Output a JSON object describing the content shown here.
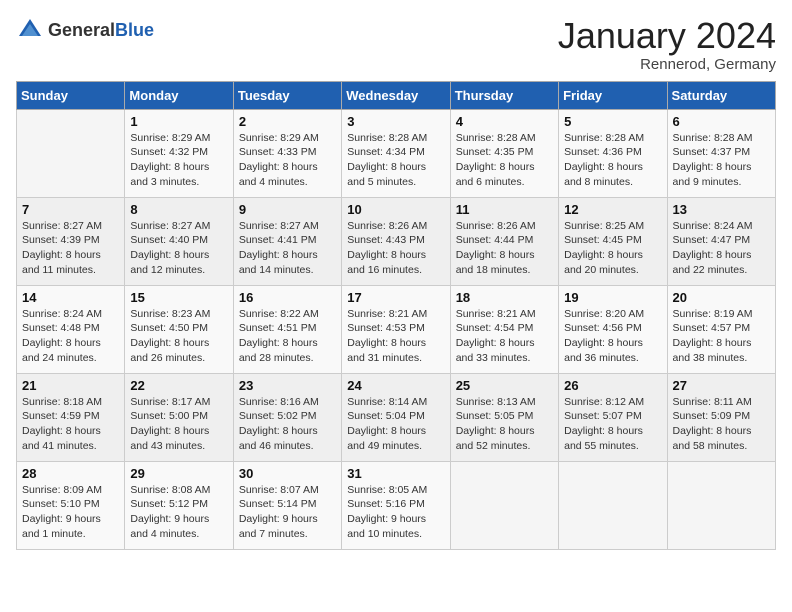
{
  "header": {
    "logo_general": "General",
    "logo_blue": "Blue",
    "month_title": "January 2024",
    "location": "Rennerod, Germany"
  },
  "weekdays": [
    "Sunday",
    "Monday",
    "Tuesday",
    "Wednesday",
    "Thursday",
    "Friday",
    "Saturday"
  ],
  "weeks": [
    [
      {
        "day": "",
        "info": ""
      },
      {
        "day": "1",
        "info": "Sunrise: 8:29 AM\nSunset: 4:32 PM\nDaylight: 8 hours\nand 3 minutes."
      },
      {
        "day": "2",
        "info": "Sunrise: 8:29 AM\nSunset: 4:33 PM\nDaylight: 8 hours\nand 4 minutes."
      },
      {
        "day": "3",
        "info": "Sunrise: 8:28 AM\nSunset: 4:34 PM\nDaylight: 8 hours\nand 5 minutes."
      },
      {
        "day": "4",
        "info": "Sunrise: 8:28 AM\nSunset: 4:35 PM\nDaylight: 8 hours\nand 6 minutes."
      },
      {
        "day": "5",
        "info": "Sunrise: 8:28 AM\nSunset: 4:36 PM\nDaylight: 8 hours\nand 8 minutes."
      },
      {
        "day": "6",
        "info": "Sunrise: 8:28 AM\nSunset: 4:37 PM\nDaylight: 8 hours\nand 9 minutes."
      }
    ],
    [
      {
        "day": "7",
        "info": "Sunrise: 8:27 AM\nSunset: 4:39 PM\nDaylight: 8 hours\nand 11 minutes."
      },
      {
        "day": "8",
        "info": "Sunrise: 8:27 AM\nSunset: 4:40 PM\nDaylight: 8 hours\nand 12 minutes."
      },
      {
        "day": "9",
        "info": "Sunrise: 8:27 AM\nSunset: 4:41 PM\nDaylight: 8 hours\nand 14 minutes."
      },
      {
        "day": "10",
        "info": "Sunrise: 8:26 AM\nSunset: 4:43 PM\nDaylight: 8 hours\nand 16 minutes."
      },
      {
        "day": "11",
        "info": "Sunrise: 8:26 AM\nSunset: 4:44 PM\nDaylight: 8 hours\nand 18 minutes."
      },
      {
        "day": "12",
        "info": "Sunrise: 8:25 AM\nSunset: 4:45 PM\nDaylight: 8 hours\nand 20 minutes."
      },
      {
        "day": "13",
        "info": "Sunrise: 8:24 AM\nSunset: 4:47 PM\nDaylight: 8 hours\nand 22 minutes."
      }
    ],
    [
      {
        "day": "14",
        "info": "Sunrise: 8:24 AM\nSunset: 4:48 PM\nDaylight: 8 hours\nand 24 minutes."
      },
      {
        "day": "15",
        "info": "Sunrise: 8:23 AM\nSunset: 4:50 PM\nDaylight: 8 hours\nand 26 minutes."
      },
      {
        "day": "16",
        "info": "Sunrise: 8:22 AM\nSunset: 4:51 PM\nDaylight: 8 hours\nand 28 minutes."
      },
      {
        "day": "17",
        "info": "Sunrise: 8:21 AM\nSunset: 4:53 PM\nDaylight: 8 hours\nand 31 minutes."
      },
      {
        "day": "18",
        "info": "Sunrise: 8:21 AM\nSunset: 4:54 PM\nDaylight: 8 hours\nand 33 minutes."
      },
      {
        "day": "19",
        "info": "Sunrise: 8:20 AM\nSunset: 4:56 PM\nDaylight: 8 hours\nand 36 minutes."
      },
      {
        "day": "20",
        "info": "Sunrise: 8:19 AM\nSunset: 4:57 PM\nDaylight: 8 hours\nand 38 minutes."
      }
    ],
    [
      {
        "day": "21",
        "info": "Sunrise: 8:18 AM\nSunset: 4:59 PM\nDaylight: 8 hours\nand 41 minutes."
      },
      {
        "day": "22",
        "info": "Sunrise: 8:17 AM\nSunset: 5:00 PM\nDaylight: 8 hours\nand 43 minutes."
      },
      {
        "day": "23",
        "info": "Sunrise: 8:16 AM\nSunset: 5:02 PM\nDaylight: 8 hours\nand 46 minutes."
      },
      {
        "day": "24",
        "info": "Sunrise: 8:14 AM\nSunset: 5:04 PM\nDaylight: 8 hours\nand 49 minutes."
      },
      {
        "day": "25",
        "info": "Sunrise: 8:13 AM\nSunset: 5:05 PM\nDaylight: 8 hours\nand 52 minutes."
      },
      {
        "day": "26",
        "info": "Sunrise: 8:12 AM\nSunset: 5:07 PM\nDaylight: 8 hours\nand 55 minutes."
      },
      {
        "day": "27",
        "info": "Sunrise: 8:11 AM\nSunset: 5:09 PM\nDaylight: 8 hours\nand 58 minutes."
      }
    ],
    [
      {
        "day": "28",
        "info": "Sunrise: 8:09 AM\nSunset: 5:10 PM\nDaylight: 9 hours\nand 1 minute."
      },
      {
        "day": "29",
        "info": "Sunrise: 8:08 AM\nSunset: 5:12 PM\nDaylight: 9 hours\nand 4 minutes."
      },
      {
        "day": "30",
        "info": "Sunrise: 8:07 AM\nSunset: 5:14 PM\nDaylight: 9 hours\nand 7 minutes."
      },
      {
        "day": "31",
        "info": "Sunrise: 8:05 AM\nSunset: 5:16 PM\nDaylight: 9 hours\nand 10 minutes."
      },
      {
        "day": "",
        "info": ""
      },
      {
        "day": "",
        "info": ""
      },
      {
        "day": "",
        "info": ""
      }
    ]
  ]
}
